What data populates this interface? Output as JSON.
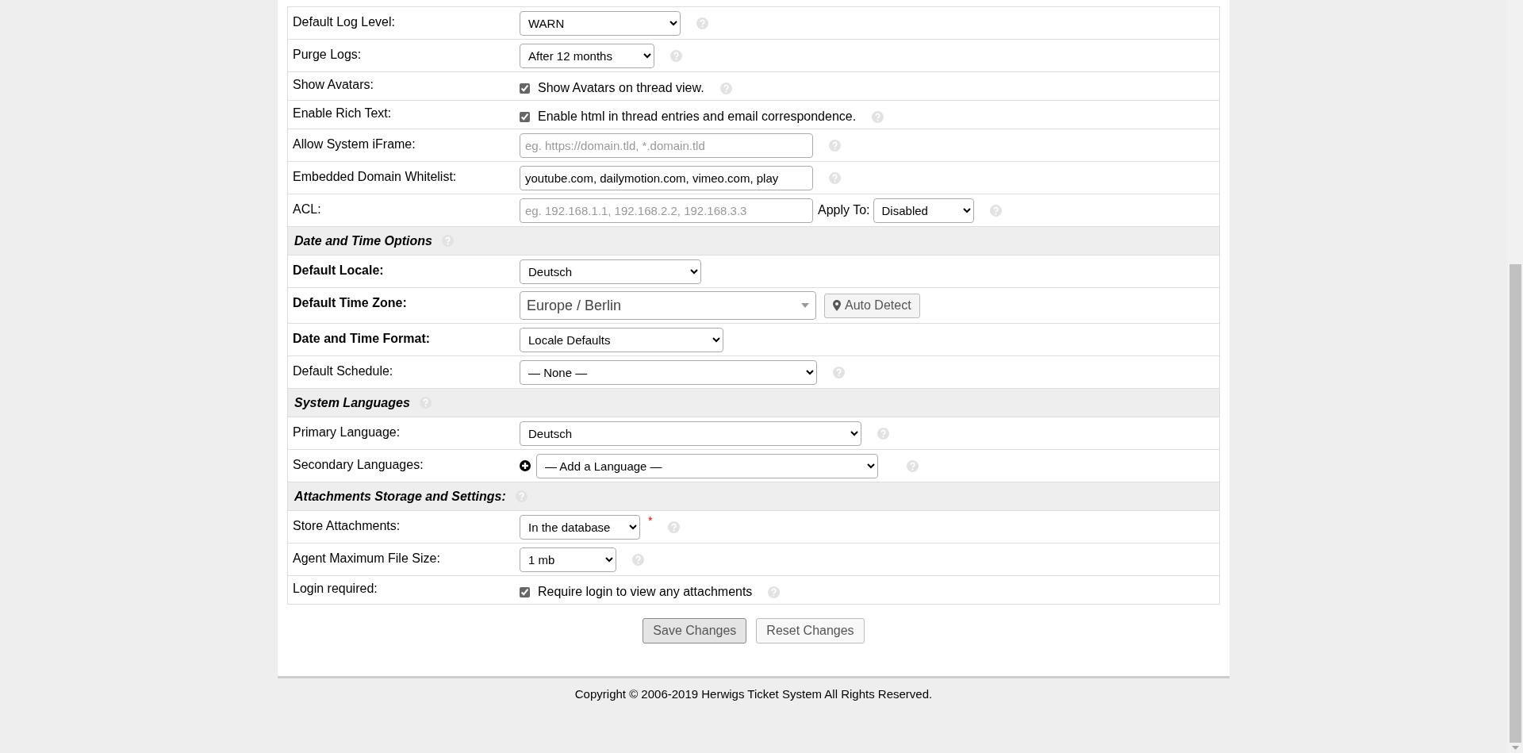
{
  "form": {
    "rows": [
      {
        "kind": "select",
        "label": "Default Log Level:",
        "bold": false,
        "value": "WARN",
        "help": true
      },
      {
        "kind": "select",
        "label": "Purge Logs:",
        "bold": false,
        "value": "After 12 months",
        "help": true
      },
      {
        "kind": "checkbox",
        "label": "Show Avatars:",
        "bold": false,
        "checked": true,
        "text": "Show Avatars on thread view.",
        "help": true
      },
      {
        "kind": "checkbox",
        "label": "Enable Rich Text:",
        "bold": false,
        "checked": true,
        "text": "Enable html in thread entries and email correspondence.",
        "help": true
      },
      {
        "kind": "text",
        "label": "Allow System iFrame:",
        "bold": false,
        "placeholder": "eg. https://domain.tld, *.domain.tld",
        "help": true
      },
      {
        "kind": "text",
        "label": "Embedded Domain Whitelist:",
        "bold": false,
        "value": "youtube.com, dailymotion.com, vimeo.com, play",
        "help": true
      },
      {
        "kind": "acl",
        "label": "ACL:",
        "bold": false,
        "placeholder": "eg. 192.168.1.1, 192.168.2.2, 192.168.3.3",
        "apply_label": "Apply To:",
        "apply_value": "Disabled",
        "help": true
      },
      {
        "kind": "header",
        "label": "Date and Time Options",
        "help": true
      },
      {
        "kind": "select",
        "label": "Default Locale:",
        "bold": true,
        "value": "Deutsch",
        "help": false
      },
      {
        "kind": "combobox",
        "label": "Default Time Zone:",
        "bold": true,
        "value": "Europe / Berlin",
        "button": "Auto Detect",
        "help": false
      },
      {
        "kind": "select",
        "label": "Date and Time Format:",
        "bold": true,
        "value": "Locale Defaults",
        "help": false
      },
      {
        "kind": "select",
        "label": "Default Schedule:",
        "bold": false,
        "value": "— None —",
        "help": true
      },
      {
        "kind": "header",
        "label": "System Languages",
        "help": true
      },
      {
        "kind": "select",
        "label": "Primary Language:",
        "bold": false,
        "value": "Deutsch",
        "help": true
      },
      {
        "kind": "add-select",
        "label": "Secondary Languages:",
        "bold": false,
        "value": "— Add a Language —",
        "help": true
      },
      {
        "kind": "header",
        "label": "Attachments Storage and Settings:",
        "help": true
      },
      {
        "kind": "select",
        "label": "Store Attachments:",
        "bold": false,
        "value": "In the database",
        "required_mark": "*",
        "help": true
      },
      {
        "kind": "select",
        "label": "Agent Maximum File Size:",
        "bold": false,
        "value": "1 mb",
        "help": true
      },
      {
        "kind": "checkbox",
        "label": "Login required:",
        "bold": false,
        "checked": true,
        "text": "Require login to view any attachments",
        "help": true
      }
    ]
  },
  "buttons": [
    {
      "label": "Save Changes",
      "kind": "primary"
    },
    {
      "label": "Reset Changes",
      "kind": "secondary"
    }
  ],
  "footer": {
    "copyright": "Copyright © 2006-2019 Herwigs Ticket System All Rights Reserved."
  }
}
